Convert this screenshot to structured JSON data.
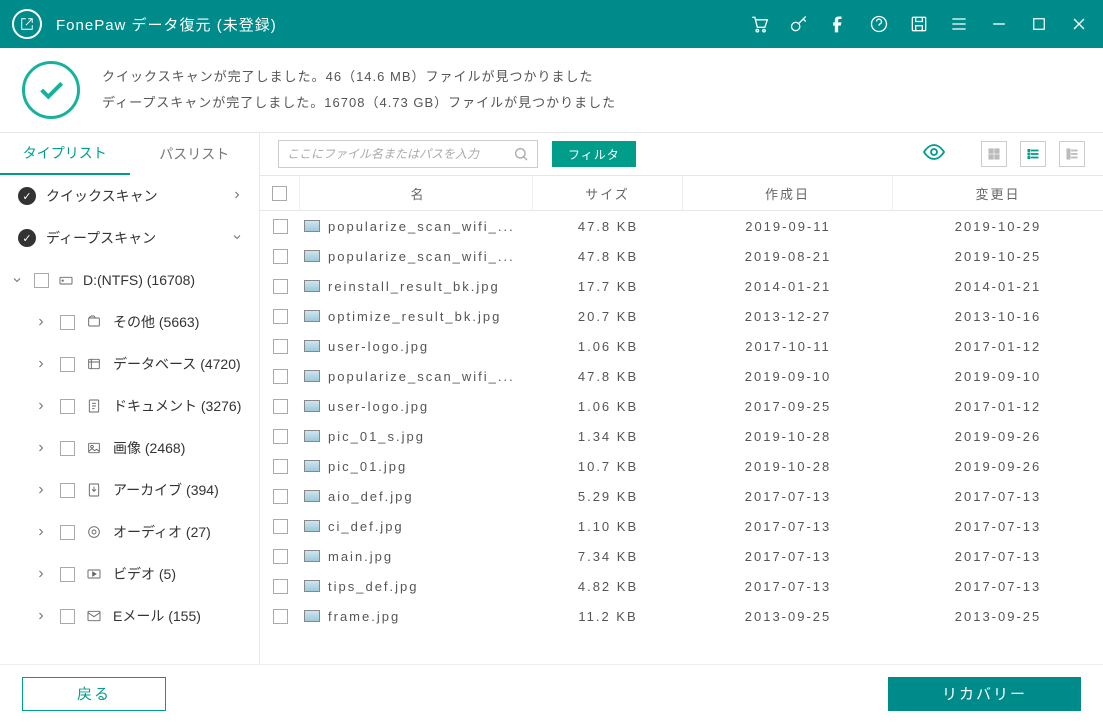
{
  "app": {
    "title": "FonePaw データ復元 (未登録)"
  },
  "banner": {
    "quick": "クイックスキャンが完了しました。46（14.6 MB）ファイルが見つかりました",
    "deep": "ディープスキャンが完了しました。16708（4.73 GB）ファイルが見つかりました"
  },
  "sidebar": {
    "tabs": {
      "type": "タイプリスト",
      "path": "パスリスト"
    },
    "quick_scan": "クイックスキャン",
    "deep_scan": "ディープスキャン",
    "drive": "D:(NTFS) (16708)",
    "categories": [
      {
        "label": "その他 (5663)"
      },
      {
        "label": "データベース (4720)"
      },
      {
        "label": "ドキュメント (3276)"
      },
      {
        "label": "画像 (2468)"
      },
      {
        "label": "アーカイブ (394)"
      },
      {
        "label": "オーディオ (27)"
      },
      {
        "label": "ビデオ (5)"
      },
      {
        "label": "Eメール (155)"
      }
    ]
  },
  "toolbar": {
    "search_placeholder": "ここにファイル名またはパスを入力",
    "filter": "フィルタ"
  },
  "table": {
    "headers": {
      "name": "名",
      "size": "サイズ",
      "created": "作成日",
      "modified": "変更日"
    },
    "rows": [
      {
        "name": "popularize_scan_wifi_...",
        "size": "47.8 KB",
        "created": "2019-09-11",
        "modified": "2019-10-29"
      },
      {
        "name": "popularize_scan_wifi_...",
        "size": "47.8 KB",
        "created": "2019-08-21",
        "modified": "2019-10-25"
      },
      {
        "name": "reinstall_result_bk.jpg",
        "size": "17.7 KB",
        "created": "2014-01-21",
        "modified": "2014-01-21"
      },
      {
        "name": "optimize_result_bk.jpg",
        "size": "20.7 KB",
        "created": "2013-12-27",
        "modified": "2013-10-16"
      },
      {
        "name": "user-logo.jpg",
        "size": "1.06 KB",
        "created": "2017-10-11",
        "modified": "2017-01-12"
      },
      {
        "name": "popularize_scan_wifi_...",
        "size": "47.8 KB",
        "created": "2019-09-10",
        "modified": "2019-09-10"
      },
      {
        "name": "user-logo.jpg",
        "size": "1.06 KB",
        "created": "2017-09-25",
        "modified": "2017-01-12"
      },
      {
        "name": "pic_01_s.jpg",
        "size": "1.34 KB",
        "created": "2019-10-28",
        "modified": "2019-09-26"
      },
      {
        "name": "pic_01.jpg",
        "size": "10.7 KB",
        "created": "2019-10-28",
        "modified": "2019-09-26"
      },
      {
        "name": "aio_def.jpg",
        "size": "5.29 KB",
        "created": "2017-07-13",
        "modified": "2017-07-13"
      },
      {
        "name": "ci_def.jpg",
        "size": "1.10 KB",
        "created": "2017-07-13",
        "modified": "2017-07-13"
      },
      {
        "name": "main.jpg",
        "size": "7.34 KB",
        "created": "2017-07-13",
        "modified": "2017-07-13"
      },
      {
        "name": "tips_def.jpg",
        "size": "4.82 KB",
        "created": "2017-07-13",
        "modified": "2017-07-13"
      },
      {
        "name": "frame.jpg",
        "size": "11.2 KB",
        "created": "2013-09-25",
        "modified": "2013-09-25"
      }
    ]
  },
  "footer": {
    "back": "戻る",
    "recover": "リカバリー"
  }
}
